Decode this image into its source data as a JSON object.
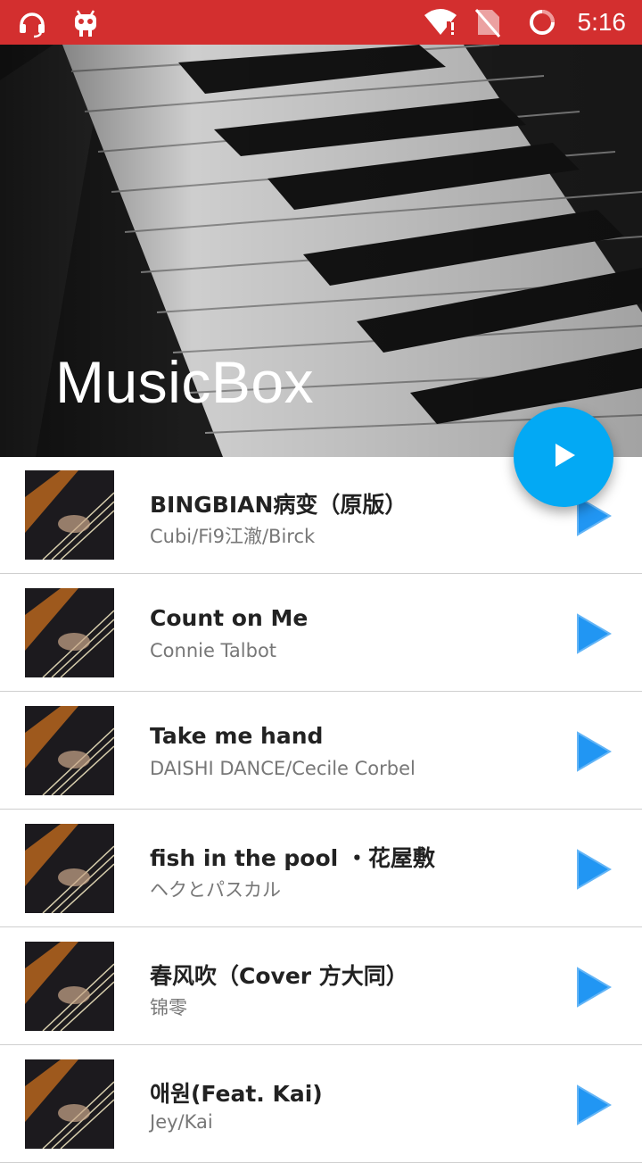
{
  "status_bar": {
    "time": "5:16",
    "left_icons": [
      "headset-icon",
      "android-debug-icon"
    ],
    "right_icons": [
      "wifi-alert-icon",
      "no-sim-icon",
      "sync-ring-icon"
    ],
    "background": "#d32f2f"
  },
  "header": {
    "title": "MusicBox"
  },
  "fab": {
    "icon": "play-icon",
    "color": "#03a9f4"
  },
  "songs": [
    {
      "title": "BINGBIAN病变（原版）",
      "artist": "Cubi/Fi9江澈/Birck"
    },
    {
      "title": "Count on Me",
      "artist": "Connie Talbot"
    },
    {
      "title": "Take me hand",
      "artist": "DAISHI DANCE/Cecile Corbel"
    },
    {
      "title": "fish in the pool ・花屋敷",
      "artist": "ヘクとパスカル"
    },
    {
      "title": "春风吹（Cover 方大同）",
      "artist": "锦零"
    },
    {
      "title": "애원(Feat. Kai)",
      "artist": "Jey/Kai"
    }
  ],
  "accent_color": "#2196f3"
}
